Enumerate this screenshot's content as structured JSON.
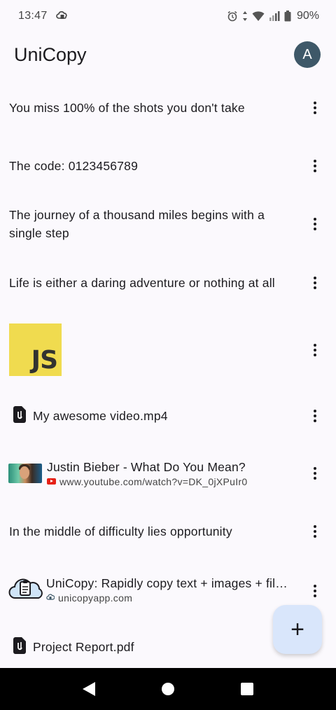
{
  "status": {
    "time": "13:47",
    "battery": "90%"
  },
  "app": {
    "title": "UniCopy",
    "avatar_letter": "A"
  },
  "items": [
    {
      "type": "text",
      "text": "You miss 100% of the shots you don't take"
    },
    {
      "type": "text",
      "text": "The code: 0123456789"
    },
    {
      "type": "text",
      "text": "The journey of a thousand miles begins with a single step"
    },
    {
      "type": "text",
      "text": "Life is either a daring adventure or nothing at all"
    },
    {
      "type": "image",
      "label": "JS"
    },
    {
      "type": "file",
      "name": "My awesome video.mp4"
    },
    {
      "type": "link",
      "title": "Justin Bieber - What Do You Mean?",
      "domain": "www.youtube.com/watch?v=DK_0jXPuIr0"
    },
    {
      "type": "text",
      "text": "In the middle of difficulty lies opportunity"
    },
    {
      "type": "link",
      "title": "UniCopy: Rapidly copy text + images + fil…",
      "domain": "unicopyapp.com"
    },
    {
      "type": "file",
      "name": "Project Report.pdf"
    }
  ],
  "fab": {
    "label": "+"
  },
  "colors": {
    "background": "#fbf9fd",
    "avatar": "#3e5868",
    "fab": "#d9e6fb",
    "js_yellow": "#f0db4f",
    "youtube_red": "#e62117"
  }
}
